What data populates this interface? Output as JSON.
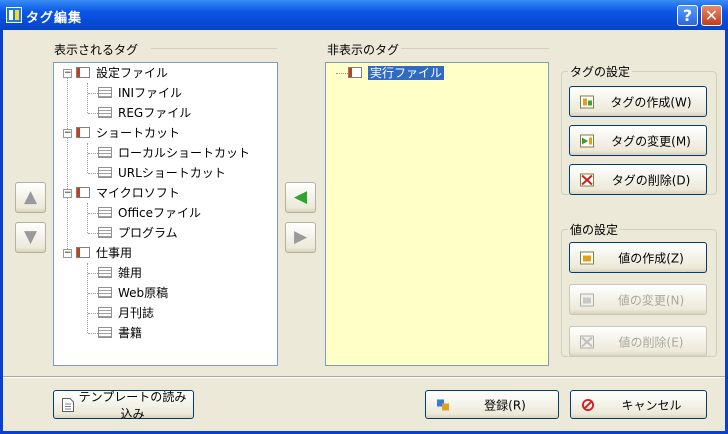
{
  "window": {
    "title": "タグ編集",
    "help_label": "?",
    "close_label": "✕",
    "icon": "app-icon"
  },
  "left_panel": {
    "label": "表示されるタグ",
    "tree": [
      {
        "label": "設定ファイル",
        "children": [
          "INIファイル",
          "REGファイル"
        ]
      },
      {
        "label": "ショートカット",
        "children": [
          "ローカルショートカット",
          "URLショートカット"
        ]
      },
      {
        "label": "マイクロソフト",
        "children": [
          "Officeファイル",
          "プログラム"
        ]
      },
      {
        "label": "仕事用",
        "children": [
          "雑用",
          "Web原稿",
          "月刊誌",
          "書籍"
        ]
      }
    ]
  },
  "right_panel": {
    "label": "非表示のタグ",
    "items": [
      "実行ファイル"
    ]
  },
  "move_buttons": {
    "up": "▲",
    "down": "▼",
    "left": "◀",
    "right": "▶"
  },
  "tag_settings": {
    "legend": "タグの設定",
    "create": "タグの作成(W)",
    "change": "タグの変更(M)",
    "delete": "タグの削除(D)"
  },
  "value_settings": {
    "legend": "値の設定",
    "create": "値の作成(Z)",
    "change": "値の変更(N)",
    "delete": "値の削除(E)"
  },
  "footer": {
    "template_load": "テンプレートの読み込み",
    "register": "登録(R)",
    "cancel": "キャンセル"
  },
  "colors": {
    "titlebar": "#0a56e6",
    "selection": "#316ac5",
    "hidden_list_bg": "#ffffc8",
    "client_bg": "#ece9d8"
  }
}
